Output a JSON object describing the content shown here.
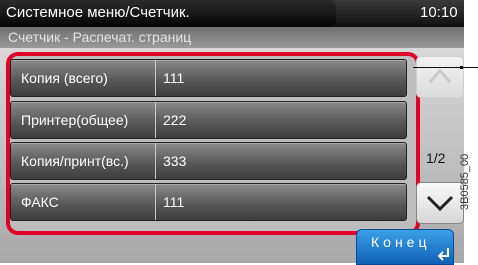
{
  "header": {
    "title": "Системное меню/Счетчик.",
    "time": "10:10"
  },
  "subtitle": "Счетчик - Распечат. страниц",
  "rows": [
    {
      "label": "Копия (всего)",
      "value": "111"
    },
    {
      "label": "Принтер(общее)",
      "value": "222"
    },
    {
      "label": "Копия/принт(вс.)",
      "value": "333"
    },
    {
      "label": "ФАКС",
      "value": "111"
    }
  ],
  "pager": {
    "indicator": "1/2"
  },
  "end_button": {
    "label": "Конец"
  },
  "figure_code": "3B0585_00",
  "colors": {
    "highlight": "#e0002a",
    "accent": "#1e78d0"
  }
}
